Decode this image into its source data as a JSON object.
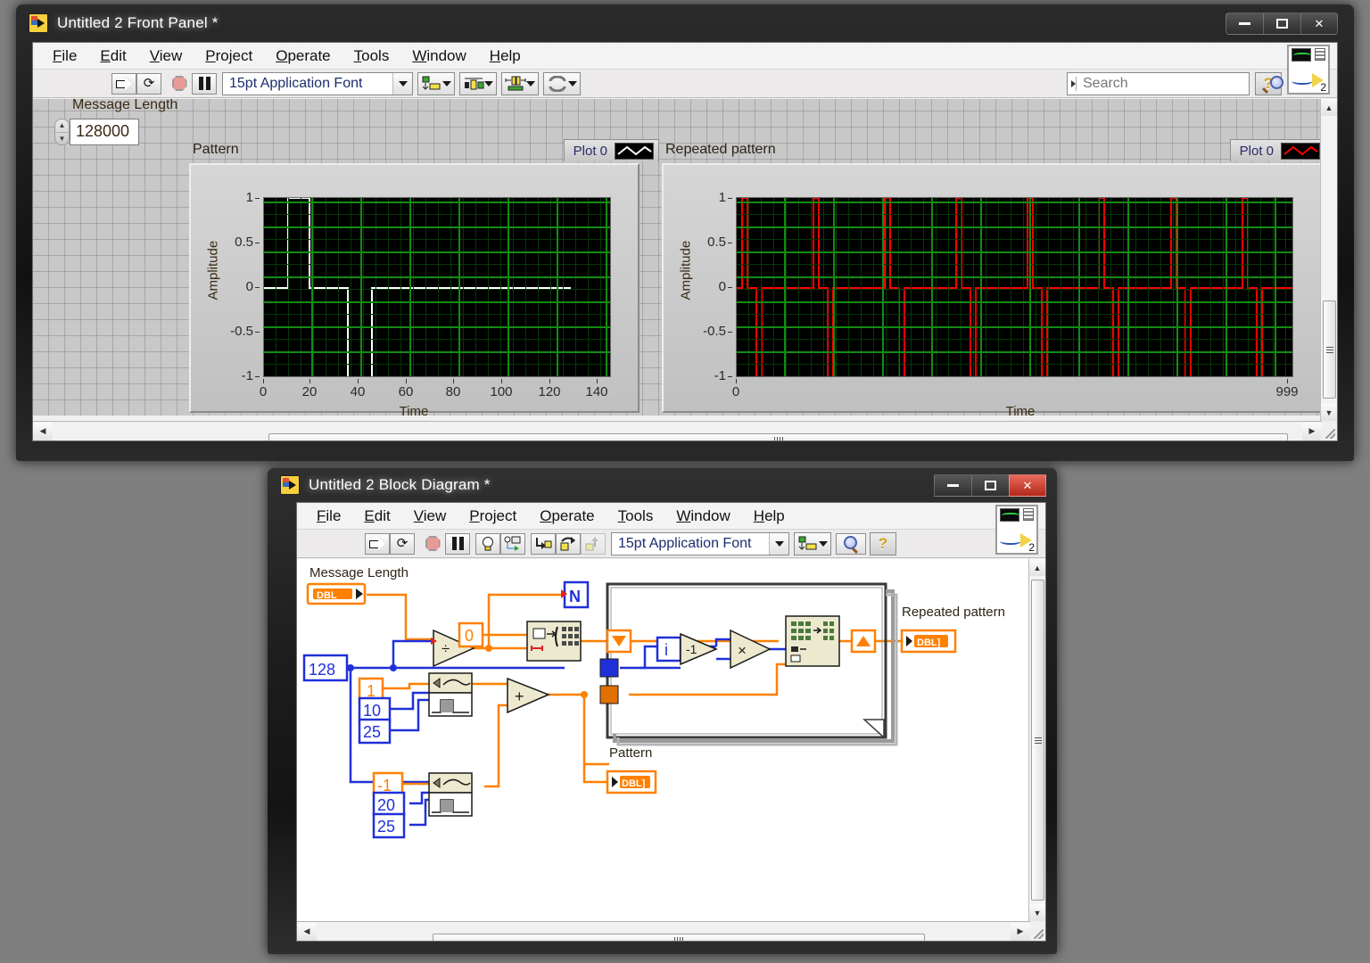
{
  "front_panel": {
    "title": "Untitled 2 Front Panel *",
    "window_buttons": {
      "minimize": "minimize-icon",
      "maximize": "maximize-icon",
      "close": "✕"
    },
    "menu": [
      {
        "label": "File",
        "mnemonic": "F"
      },
      {
        "label": "Edit",
        "mnemonic": "E"
      },
      {
        "label": "View",
        "mnemonic": "V"
      },
      {
        "label": "Project",
        "mnemonic": "P"
      },
      {
        "label": "Operate",
        "mnemonic": "O"
      },
      {
        "label": "Tools",
        "mnemonic": "T"
      },
      {
        "label": "Window",
        "mnemonic": "W"
      },
      {
        "label": "Help",
        "mnemonic": "H"
      }
    ],
    "toolbar": {
      "run": "run-arrow-icon",
      "run_continuously": "run-continuously-icon",
      "abort": "abort-execution-icon",
      "pause": "pause-icon",
      "font_selector": "15pt Application Font",
      "align_objects": "align-objects-icon",
      "distribute_objects": "distribute-objects-icon",
      "resize_objects": "resize-objects-icon",
      "reorder": "reorder-icon",
      "help": "?",
      "vi_icon_number": "2"
    },
    "search": {
      "placeholder": "Search",
      "value": ""
    },
    "controls": {
      "message_length": {
        "label": "Message Length",
        "value": "128000"
      }
    },
    "graphs": [
      {
        "title": "Pattern",
        "legend_label": "Plot 0",
        "legend_color": "#ffffff",
        "ylabel": "Amplitude",
        "xlabel": "Time",
        "yticks": [
          "1",
          "0.5",
          "0",
          "-0.5",
          "-1"
        ],
        "xticks": [
          "0",
          "20",
          "40",
          "60",
          "80",
          "100",
          "120",
          "140"
        ]
      },
      {
        "title": "Repeated pattern",
        "legend_label": "Plot 0",
        "legend_color": "#ff0000",
        "ylabel": "Amplitude",
        "xlabel": "Time",
        "yticks": [
          "1",
          "0.5",
          "0",
          "-0.5",
          "-1"
        ],
        "xticks": [
          "0",
          "999"
        ]
      }
    ]
  },
  "chart_data": [
    {
      "type": "line",
      "title": "Pattern",
      "xlabel": "Time",
      "ylabel": "Amplitude",
      "xlim": [
        0,
        145
      ],
      "ylim": [
        -1,
        1
      ],
      "grid": true,
      "legend": "Plot 0",
      "plot_color": "#ffffff",
      "background": "#000000",
      "series": [
        {
          "name": "Plot 0",
          "x": [
            0,
            10,
            10,
            19,
            19,
            35,
            35,
            45,
            45,
            128
          ],
          "y": [
            0,
            0,
            1,
            1,
            0,
            0,
            -1,
            -1,
            0,
            0
          ]
        }
      ]
    },
    {
      "type": "line",
      "title": "Repeated pattern",
      "xlabel": "Time",
      "ylabel": "Amplitude",
      "xlim": [
        0,
        999
      ],
      "ylim": [
        -1,
        1
      ],
      "grid": true,
      "legend": "Plot 0",
      "plot_color": "#ff0000",
      "background": "#000000",
      "period": 128,
      "repeats": 8,
      "series": [
        {
          "name": "Plot 0",
          "note": "Pattern repeated 8 times with period 128 over 0..999",
          "pulse_high_start": 10,
          "pulse_high_end": 19,
          "pulse_low_start": 35,
          "pulse_low_end": 45
        }
      ]
    }
  ],
  "block_diagram": {
    "title": "Untitled 2 Block Diagram *",
    "window_buttons": {
      "minimize": "minimize-icon",
      "maximize": "maximize-icon",
      "close": "✕"
    },
    "menu": [
      {
        "label": "File",
        "mnemonic": "F"
      },
      {
        "label": "Edit",
        "mnemonic": "E"
      },
      {
        "label": "View",
        "mnemonic": "V"
      },
      {
        "label": "Project",
        "mnemonic": "P"
      },
      {
        "label": "Operate",
        "mnemonic": "O"
      },
      {
        "label": "Tools",
        "mnemonic": "T"
      },
      {
        "label": "Window",
        "mnemonic": "W"
      },
      {
        "label": "Help",
        "mnemonic": "H"
      }
    ],
    "toolbar": {
      "run": "run-arrow-icon",
      "run_continuously": "run-continuously-icon",
      "abort": "abort-execution-icon",
      "pause": "pause-icon",
      "highlight_execution": "lightbulb-icon",
      "retain_wire_values": "retain-wire-values-icon",
      "step_into": "step-into-icon",
      "step_over": "step-over-icon",
      "step_out": "step-out-icon",
      "font_selector": "15pt Application Font",
      "clean_up_diagram": "clean-up-diagram-icon",
      "search_zoom": "search-icon",
      "help": "?",
      "vi_icon_number": "2"
    },
    "diagram": {
      "message_length_label": "Message Length",
      "message_length_terminal": "DBL",
      "pattern_label": "Pattern",
      "pattern_terminal": "DBL]",
      "repeated_pattern_label": "Repeated pattern",
      "repeated_pattern_terminal": "DBL]",
      "loop_count_terminal": "N",
      "iteration_terminal": "i",
      "constants": {
        "divisor": "128",
        "init_value": "0",
        "pulse1_amplitude": "1",
        "pulse1_delay": "10",
        "pulse1_width": "25",
        "pulse2_amplitude": "-1",
        "pulse2_delay": "20",
        "pulse2_width": "25",
        "negate": "-1"
      },
      "nodes": {
        "divide": "÷",
        "add": "+",
        "multiply": "×",
        "initialize_array": "initialize-array-icon",
        "replace_array_subset": "replace-array-subset-icon",
        "pulse_pattern_1": "pulse-pattern-vi-icon",
        "pulse_pattern_2": "pulse-pattern-vi-icon"
      }
    }
  }
}
